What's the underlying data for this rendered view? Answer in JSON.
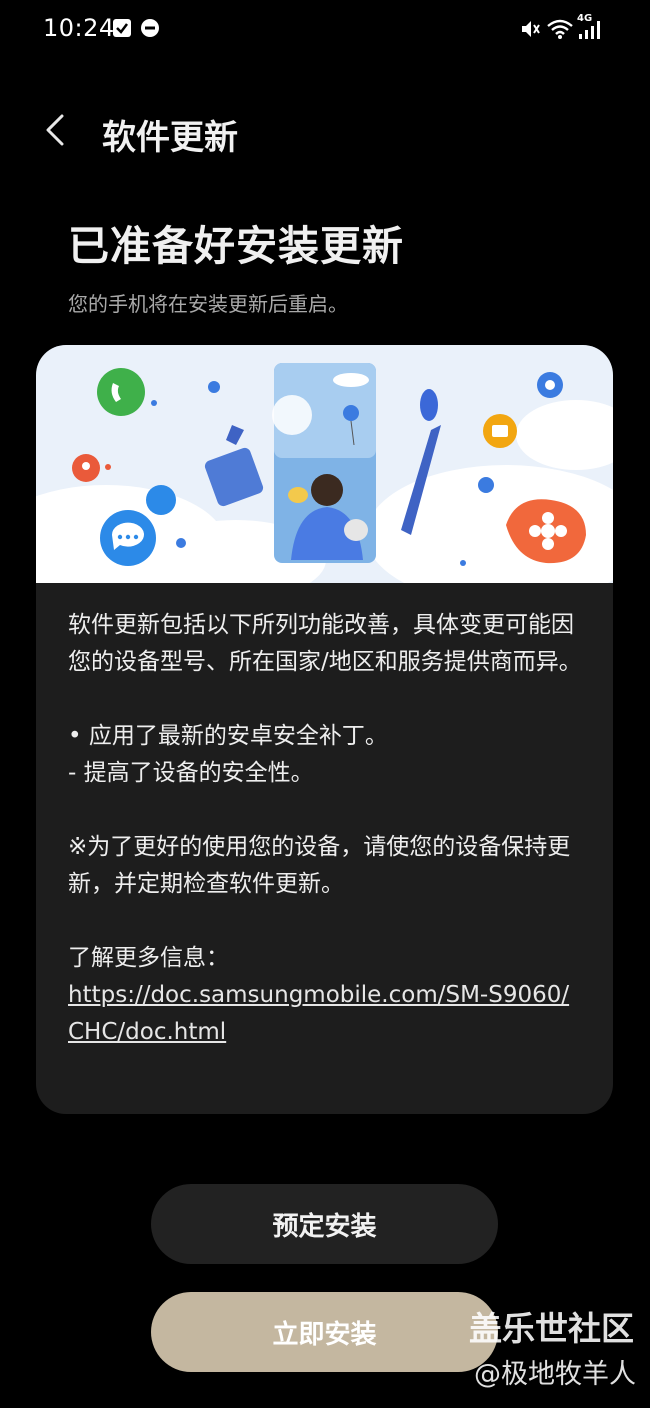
{
  "status_bar": {
    "time": "10:24",
    "network_label": "4G",
    "icons": [
      "checkbox-notification-icon",
      "do-not-disturb-icon",
      "mute-icon",
      "wifi-icon",
      "signal-icon"
    ]
  },
  "header": {
    "back_icon": "chevron-left-icon",
    "title": "软件更新"
  },
  "main": {
    "title": "已准备好安装更新",
    "subtitle": "您的手机将在安装更新后重启。"
  },
  "card": {
    "intro": "软件更新包括以下所列功能改善，具体变更可能因您的设备型号、所在国家/地区和服务提供商而异。",
    "bullet": "• 应用了最新的安卓安全补丁。",
    "sub_bullet": " - 提高了设备的安全性。",
    "note": "※为了更好的使用您的设备，请使您的设备保持更新，并定期检查软件更新。",
    "more_info_label": "了解更多信息：",
    "link": "https://doc.samsungmobile.com/SM-S9060/CHC/doc.html"
  },
  "buttons": {
    "schedule": "预定安装",
    "install_now": "立即安装"
  },
  "watermark": {
    "main": "盖乐世社区",
    "sub": "@极地牧羊人"
  },
  "colors": {
    "background": "#000000",
    "card": "#1d1d1d",
    "install_button": "#c4b7a0",
    "schedule_button": "#222222"
  }
}
